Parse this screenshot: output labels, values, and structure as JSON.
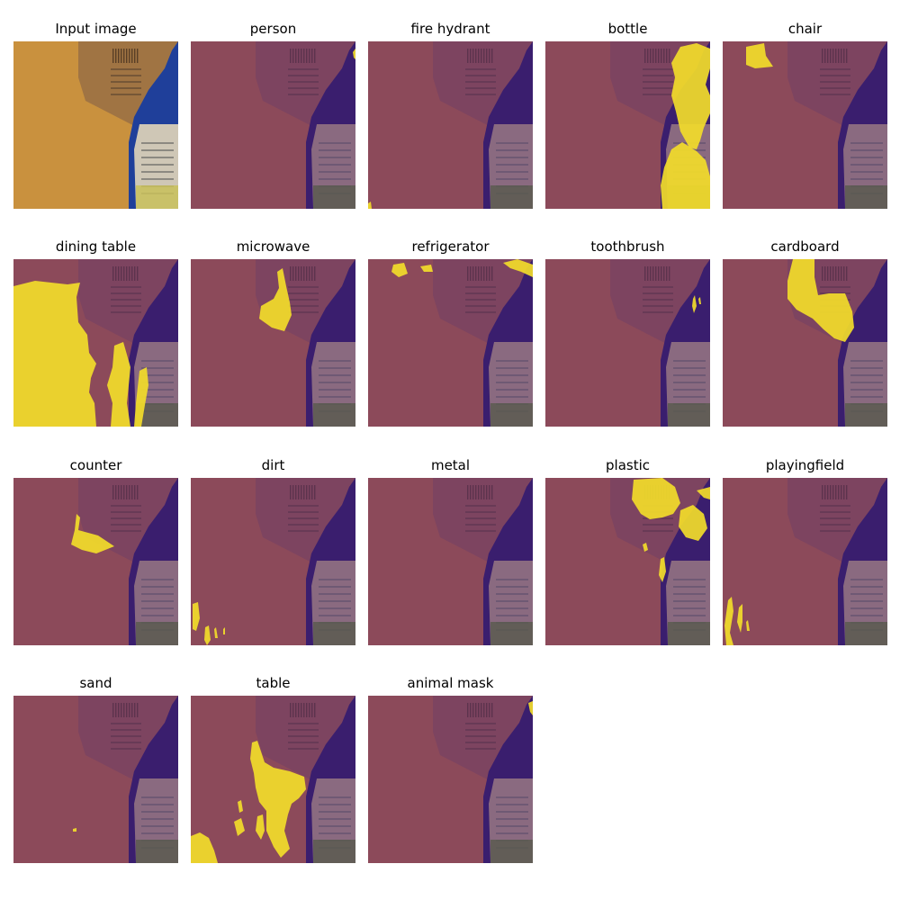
{
  "panels": [
    {
      "title": "Input image",
      "kind": "input",
      "mask": ""
    },
    {
      "title": "person",
      "kind": "overlay",
      "mask": "person"
    },
    {
      "title": "fire hydrant",
      "kind": "overlay",
      "mask": "fire-hydrant"
    },
    {
      "title": "bottle",
      "kind": "overlay",
      "mask": "bottle"
    },
    {
      "title": "chair",
      "kind": "overlay",
      "mask": "chair"
    },
    {
      "title": "dining table",
      "kind": "overlay",
      "mask": "dining-table"
    },
    {
      "title": "microwave",
      "kind": "overlay",
      "mask": "microwave"
    },
    {
      "title": "refrigerator",
      "kind": "overlay",
      "mask": "refrigerator"
    },
    {
      "title": "toothbrush",
      "kind": "overlay",
      "mask": "toothbrush"
    },
    {
      "title": "cardboard",
      "kind": "overlay",
      "mask": "cardboard"
    },
    {
      "title": "counter",
      "kind": "overlay",
      "mask": "counter"
    },
    {
      "title": "dirt",
      "kind": "overlay",
      "mask": "dirt"
    },
    {
      "title": "metal",
      "kind": "overlay",
      "mask": "metal"
    },
    {
      "title": "plastic",
      "kind": "overlay",
      "mask": "plastic"
    },
    {
      "title": "playingfield",
      "kind": "overlay",
      "mask": "playingfield"
    },
    {
      "title": "sand",
      "kind": "overlay",
      "mask": "sand"
    },
    {
      "title": "table",
      "kind": "overlay",
      "mask": "table"
    },
    {
      "title": "animal mask",
      "kind": "overlay",
      "mask": "animal-mask"
    }
  ],
  "colors": {
    "table_input": "#c9913e",
    "box_input": "#a07443",
    "bottle_input": "#1f3f9a",
    "label_input": "#cfc7b6",
    "overlay_table": "#8c4a5a",
    "overlay_box": "#7d4460",
    "overlay_bottle": "#3a1e6e",
    "overlay_label": "#8a6a80",
    "mask_yellow": "#f2dc2a"
  }
}
